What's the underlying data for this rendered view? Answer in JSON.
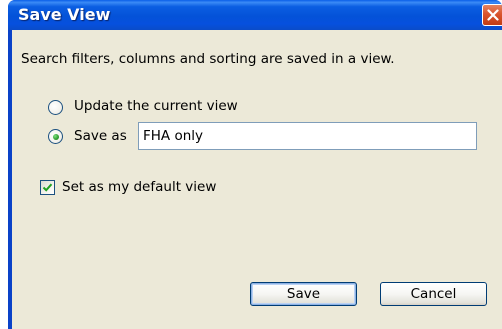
{
  "window": {
    "title": "Save View",
    "close_icon": "close-x-icon"
  },
  "dialog": {
    "description": "Search filters, columns and sorting are saved in a view.",
    "options": {
      "update_label": "Update the current view",
      "update_selected": false,
      "save_as_label": "Save as",
      "save_as_selected": true,
      "save_as_value": "FHA only"
    },
    "default_view": {
      "label": "Set as my default view",
      "checked": true
    },
    "buttons": {
      "save_label": "Save",
      "cancel_label": "Cancel"
    }
  },
  "colors": {
    "titlebar": "#0452d8",
    "client_bg": "#ece9d8",
    "close_button": "#d9542e",
    "radio_dot": "#2f9d2f",
    "check_mark": "#21a121"
  }
}
